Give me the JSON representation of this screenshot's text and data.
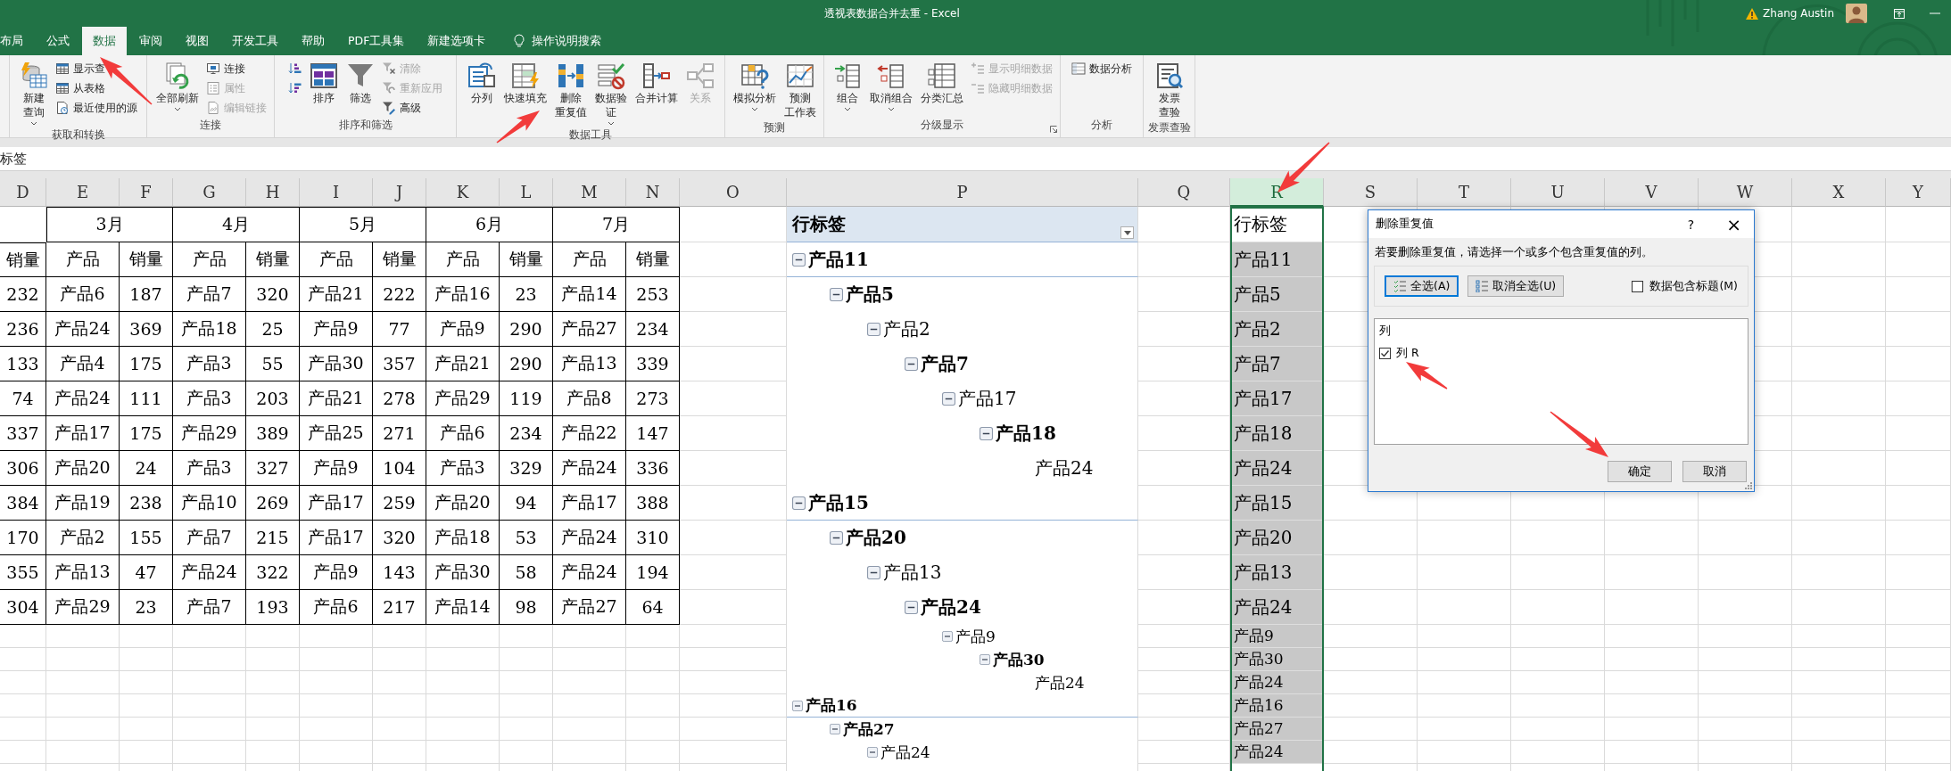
{
  "window": {
    "title": "透视表数据合并去重 - Excel",
    "user": "Zhang Austin"
  },
  "tabs": [
    {
      "label": "布局",
      "selected": false
    },
    {
      "label": "公式",
      "selected": false
    },
    {
      "label": "数据",
      "selected": true
    },
    {
      "label": "审阅",
      "selected": false
    },
    {
      "label": "视图",
      "selected": false
    },
    {
      "label": "开发工具",
      "selected": false
    },
    {
      "label": "帮助",
      "selected": false
    },
    {
      "label": "PDF工具集",
      "selected": false
    },
    {
      "label": "新建选项卡",
      "selected": false
    }
  ],
  "tell_me": "操作说明搜索",
  "ribbon": {
    "groups": [
      {
        "label": "获取和转换",
        "items": [
          {
            "kind": "large",
            "lines": [
              "新建",
              "查询"
            ],
            "dropdown": true,
            "disabled": false
          },
          {
            "kind": "stack",
            "items": [
              {
                "label": "显示查",
                "disabled": false
              },
              {
                "label": "从表格",
                "disabled": false
              },
              {
                "label": "最近使用的源",
                "disabled": false
              }
            ]
          }
        ]
      },
      {
        "label": "连接",
        "items": [
          {
            "kind": "large",
            "lines": [
              "全部刷新"
            ],
            "dropdown": true,
            "disabled": false
          },
          {
            "kind": "stack",
            "items": [
              {
                "label": "连接",
                "disabled": false
              },
              {
                "label": "属性",
                "disabled": true
              },
              {
                "label": "编辑链接",
                "disabled": true
              }
            ]
          }
        ]
      },
      {
        "label": "排序和筛选",
        "items": [
          {
            "kind": "stack",
            "items": [
              {
                "disabled": false
              },
              {
                "disabled": false
              }
            ]
          },
          {
            "kind": "large",
            "lines": [
              "排序"
            ],
            "dropdown": false,
            "disabled": false
          },
          {
            "kind": "large",
            "lines": [
              "筛选"
            ],
            "dropdown": false,
            "disabled": false
          },
          {
            "kind": "stack",
            "items": [
              {
                "label": "清除",
                "disabled": true
              },
              {
                "label": "重新应用",
                "disabled": true
              },
              {
                "label": "高级",
                "disabled": false
              }
            ]
          }
        ]
      },
      {
        "label": "数据工具",
        "items": [
          {
            "kind": "large",
            "lines": [
              "分列"
            ],
            "dropdown": false,
            "disabled": false
          },
          {
            "kind": "large",
            "lines": [
              "快速填充"
            ],
            "dropdown": false,
            "disabled": false
          },
          {
            "kind": "large",
            "lines": [
              "删除",
              "重复值"
            ],
            "dropdown": false,
            "disabled": false
          },
          {
            "kind": "large",
            "lines": [
              "数据验",
              "证"
            ],
            "dropdown": true,
            "disabled": false
          },
          {
            "kind": "large",
            "lines": [
              "合并计算"
            ],
            "dropdown": false,
            "disabled": false
          },
          {
            "kind": "large",
            "lines": [
              "关系"
            ],
            "dropdown": false,
            "disabled": true
          }
        ]
      },
      {
        "label": "预测",
        "items": [
          {
            "kind": "large",
            "lines": [
              "模拟分析"
            ],
            "dropdown": true,
            "disabled": false
          },
          {
            "kind": "large",
            "lines": [
              "预测",
              "工作表"
            ],
            "dropdown": false,
            "disabled": false
          }
        ]
      },
      {
        "label": "分级显示",
        "launcher": true,
        "items": [
          {
            "kind": "large",
            "lines": [
              "组合"
            ],
            "dropdown": true,
            "disabled": false
          },
          {
            "kind": "large",
            "lines": [
              "取消组合"
            ],
            "dropdown": true,
            "disabled": false
          },
          {
            "kind": "large",
            "lines": [
              "分类汇总"
            ],
            "dropdown": false,
            "disabled": false
          },
          {
            "kind": "stack",
            "items": [
              {
                "label": "显示明细数据",
                "disabled": true
              },
              {
                "label": "隐藏明细数据",
                "disabled": true
              }
            ]
          }
        ]
      },
      {
        "label": "分析",
        "items": [
          {
            "kind": "stack",
            "items": [
              {
                "label": "数据分析",
                "disabled": false
              }
            ]
          }
        ]
      },
      {
        "label": "发票查验",
        "items": [
          {
            "kind": "large",
            "lines": [
              "发票",
              "查验"
            ],
            "dropdown": false,
            "disabled": false
          }
        ]
      }
    ]
  },
  "formula_bar": {
    "value": "标签"
  },
  "columns": [
    {
      "label": "D",
      "selected": false
    },
    {
      "label": "E",
      "selected": false
    },
    {
      "label": "F",
      "selected": false
    },
    {
      "label": "G",
      "selected": false
    },
    {
      "label": "H",
      "selected": false
    },
    {
      "label": "I",
      "selected": false
    },
    {
      "label": "J",
      "selected": false
    },
    {
      "label": "K",
      "selected": false
    },
    {
      "label": "L",
      "selected": false
    },
    {
      "label": "M",
      "selected": false
    },
    {
      "label": "N",
      "selected": false
    },
    {
      "label": "O",
      "selected": false
    },
    {
      "label": "P",
      "selected": false
    },
    {
      "label": "Q",
      "selected": false
    },
    {
      "label": "R",
      "selected": true
    },
    {
      "label": "S",
      "selected": false
    },
    {
      "label": "T",
      "selected": false
    },
    {
      "label": "U",
      "selected": false
    },
    {
      "label": "V",
      "selected": false
    },
    {
      "label": "W",
      "selected": false
    },
    {
      "label": "X",
      "selected": false
    },
    {
      "label": "Y",
      "selected": false
    }
  ],
  "sales_table": {
    "months": [
      "3月",
      "4月",
      "5月",
      "6月",
      "7月"
    ],
    "header": [
      "销量",
      "产品",
      "销量",
      "产品",
      "销量",
      "产品",
      "销量",
      "产品",
      "销量",
      "产品",
      "销量"
    ],
    "rows": [
      [
        "232",
        "产品6",
        "187",
        "产品7",
        "320",
        "产品21",
        "222",
        "产品16",
        "23",
        "产品14",
        "253"
      ],
      [
        "236",
        "产品24",
        "369",
        "产品18",
        "25",
        "产品9",
        "77",
        "产品9",
        "290",
        "产品27",
        "234"
      ],
      [
        "133",
        "产品4",
        "175",
        "产品3",
        "55",
        "产品30",
        "357",
        "产品21",
        "290",
        "产品13",
        "339"
      ],
      [
        "74",
        "产品24",
        "111",
        "产品3",
        "203",
        "产品21",
        "278",
        "产品29",
        "119",
        "产品8",
        "273"
      ],
      [
        "337",
        "产品17",
        "175",
        "产品29",
        "389",
        "产品25",
        "271",
        "产品6",
        "234",
        "产品22",
        "147"
      ],
      [
        "306",
        "产品20",
        "24",
        "产品3",
        "327",
        "产品9",
        "104",
        "产品3",
        "329",
        "产品24",
        "336"
      ],
      [
        "384",
        "产品19",
        "238",
        "产品10",
        "269",
        "产品17",
        "259",
        "产品20",
        "94",
        "产品17",
        "388"
      ],
      [
        "170",
        "产品2",
        "155",
        "产品7",
        "215",
        "产品17",
        "320",
        "产品18",
        "53",
        "产品24",
        "310"
      ],
      [
        "355",
        "产品13",
        "47",
        "产品24",
        "322",
        "产品9",
        "143",
        "产品30",
        "58",
        "产品24",
        "194"
      ],
      [
        "304",
        "产品29",
        "23",
        "产品7",
        "193",
        "产品6",
        "217",
        "产品14",
        "98",
        "产品27",
        "64"
      ]
    ]
  },
  "pivot": {
    "header": "行标签",
    "rows": [
      {
        "label": "产品11",
        "expanded": true,
        "children": [
          {
            "label": "产品5",
            "expanded": true,
            "children": [
              {
                "label": "产品2",
                "expanded": true,
                "children": [
                  {
                    "label": "产品7",
                    "expanded": true,
                    "children": [
                      {
                        "label": "产品17",
                        "expanded": true,
                        "children": [
                          {
                            "label": "产品18",
                            "expanded": true,
                            "children": [
                              {
                                "label": "产品24"
                              }
                            ]
                          }
                        ]
                      }
                    ]
                  }
                ]
              }
            ]
          }
        ]
      },
      {
        "label": "产品15",
        "expanded": true,
        "children": [
          {
            "label": "产品20",
            "expanded": true,
            "children": [
              {
                "label": "产品13",
                "expanded": true,
                "children": [
                  {
                    "label": "产品24",
                    "expanded": true,
                    "children": [
                      {
                        "label": "产品9",
                        "expanded": true,
                        "children": [
                          {
                            "label": "产品30",
                            "expanded": true,
                            "children": [
                              {
                                "label": "产品24"
                              }
                            ]
                          }
                        ]
                      }
                    ]
                  }
                ]
              }
            ]
          }
        ]
      },
      {
        "label": "产品16",
        "expanded": true,
        "children": [
          {
            "label": "产品27",
            "expanded": true,
            "children": [
              {
                "label": "产品24",
                "expanded": true
              }
            ]
          }
        ]
      }
    ]
  },
  "copied_column": {
    "header": "行标签",
    "values": [
      "产品11",
      "产品5",
      "产品2",
      "产品7",
      "产品17",
      "产品18",
      "产品24",
      "产品15",
      "产品20",
      "产品13",
      "产品24",
      "产品9",
      "产品30",
      "产品24",
      "产品16",
      "产品27",
      "产品24"
    ]
  },
  "dialog": {
    "title": "删除重复值",
    "help": "?",
    "close": "×",
    "instruction": "若要删除重复值，请选择一个或多个包含重复值的列。",
    "select_all": "全选(A)",
    "unselect_all": "取消全选(U)",
    "has_headers": {
      "label": "数据包含标题(M)",
      "checked": false
    },
    "list_header": "列",
    "columns": [
      {
        "label": "列 R",
        "checked": true
      }
    ],
    "ok": "确定",
    "cancel": "取消"
  }
}
